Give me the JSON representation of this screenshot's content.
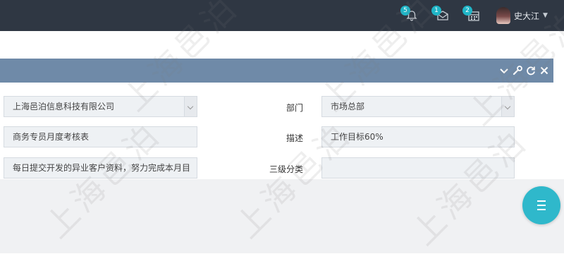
{
  "header": {
    "notifications": [
      {
        "icon": "bell-icon",
        "count": "5"
      },
      {
        "icon": "mail-icon",
        "count": "1"
      },
      {
        "icon": "calendar-icon",
        "count": "2"
      }
    ],
    "user": {
      "name": "史大江"
    }
  },
  "panel": {
    "tools": [
      "collapse-icon",
      "wrench-icon",
      "refresh-icon",
      "close-icon"
    ]
  },
  "form": {
    "company": {
      "value": "上海邑泊信息科技有限公司"
    },
    "department": {
      "label": "部门",
      "value": "市场总部"
    },
    "name": {
      "value": "商务专员月度考核表"
    },
    "description": {
      "label": "描述",
      "value": "工作目标60%"
    },
    "content": {
      "value": "每日提交开发的异业客户资料，努力完成本月目"
    },
    "category3": {
      "label": "三级分类",
      "value": ""
    }
  },
  "watermark": {
    "text": "上海邑泊"
  },
  "colors": {
    "topbar": "#2f3743",
    "panel_header": "#6f8aa8",
    "accent": "#2fb8cb"
  }
}
